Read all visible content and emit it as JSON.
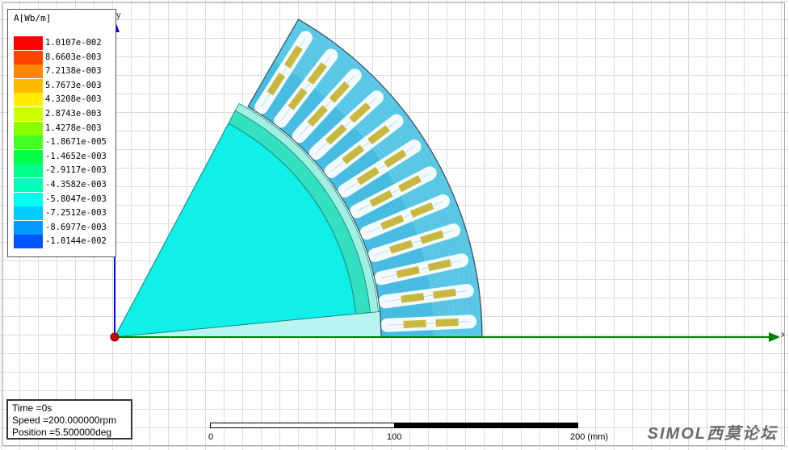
{
  "legend": {
    "title": "A[Wb/m]",
    "entries": [
      {
        "label": "1.0107e-002",
        "color": "#ff0000"
      },
      {
        "label": "8.6603e-003",
        "color": "#ff4400"
      },
      {
        "label": "7.2138e-003",
        "color": "#ff8800"
      },
      {
        "label": "5.7673e-003",
        "color": "#ffbb00"
      },
      {
        "label": "4.3208e-003",
        "color": "#ffee00"
      },
      {
        "label": "2.8743e-003",
        "color": "#ccff00"
      },
      {
        "label": "1.4278e-003",
        "color": "#88ff00"
      },
      {
        "label": "-1.8671e-005",
        "color": "#44ff22"
      },
      {
        "label": "-1.4652e-003",
        "color": "#00ff44"
      },
      {
        "label": "-2.9117e-003",
        "color": "#00ff88"
      },
      {
        "label": "-4.3582e-003",
        "color": "#00ffbb"
      },
      {
        "label": "-5.8047e-003",
        "color": "#00ffee"
      },
      {
        "label": "-7.2512e-003",
        "color": "#00ccff"
      },
      {
        "label": "-8.6977e-003",
        "color": "#0099ff"
      },
      {
        "label": "-1.0144e-002",
        "color": "#0055ff"
      }
    ]
  },
  "status": {
    "time": "Time    =0s",
    "speed": "Speed   =200.000000rpm",
    "position": "Position =5.500000deg"
  },
  "axes": {
    "x_label": "x",
    "y_label": "y"
  },
  "scale": {
    "tick0": "0",
    "tick1": "100",
    "tick2": "200 (mm)"
  },
  "watermark": "SIMOL西莫论坛",
  "colors": {
    "rotor": "#10f0e8",
    "stator": "#4dd6e8",
    "coil": "#c8b840",
    "x_axis": "#008000",
    "y_axis": "#0000ff",
    "origin": "#cc0000"
  }
}
